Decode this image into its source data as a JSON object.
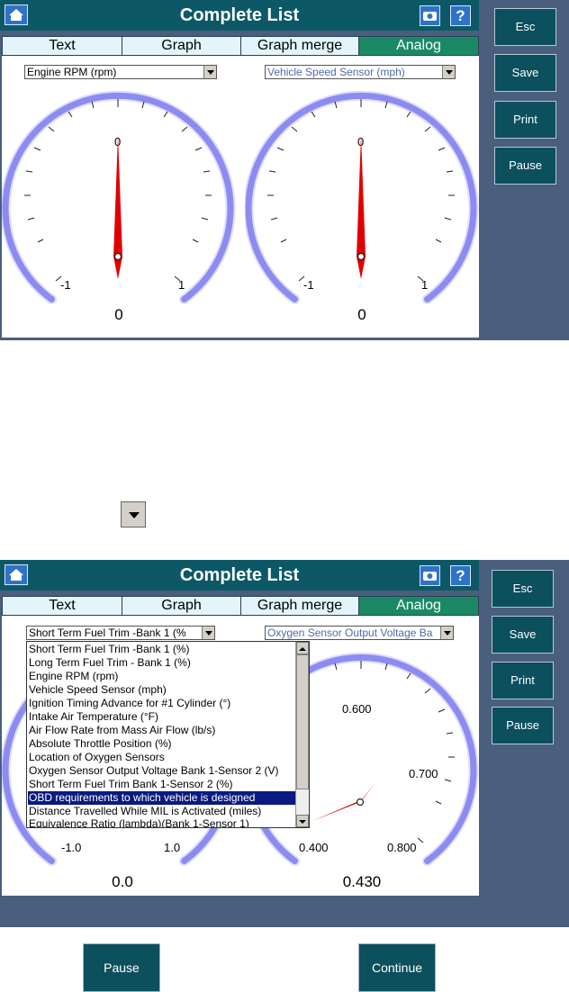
{
  "top_screen": {
    "title": "Complete List",
    "tabs": [
      {
        "label": "Text",
        "active": false
      },
      {
        "label": "Graph",
        "active": false
      },
      {
        "label": "Graph merge",
        "active": false
      },
      {
        "label": "Analog",
        "active": true
      }
    ],
    "side_buttons": [
      "Esc",
      "Save",
      "Print",
      "Pause"
    ],
    "left_select": "Engine RPM (rpm)",
    "right_select": "Vehicle Speed Sensor (mph)",
    "left_gauge": {
      "min_label": "-1",
      "mid_label": "0",
      "max_label": "1",
      "value": "0"
    },
    "right_gauge": {
      "min_label": "-1",
      "mid_label": "0",
      "max_label": "1",
      "value": "0"
    }
  },
  "bottom_screen": {
    "title": "Complete List",
    "tabs": [
      {
        "label": "Text",
        "active": false
      },
      {
        "label": "Graph",
        "active": false
      },
      {
        "label": "Graph merge",
        "active": false
      },
      {
        "label": "Analog",
        "active": true
      }
    ],
    "side_buttons": [
      "Esc",
      "Save",
      "Print",
      "Pause"
    ],
    "left_select": "Short Term Fuel Trim -Bank 1 (%",
    "right_select": "Oxygen Sensor Output Voltage Ba",
    "dropdown_items": [
      "Short Term Fuel Trim -Bank 1 (%)",
      "Long Term Fuel Trim - Bank 1 (%)",
      "Engine RPM (rpm)",
      "Vehicle Speed Sensor (mph)",
      "Ignition Timing Advance for #1 Cylinder (°)",
      "Intake Air Temperature (°F)",
      "Air Flow Rate from Mass Air Flow (lb/s)",
      "Absolute Throttle Position (%)",
      "Location of Oxygen Sensors",
      "Oxygen Sensor Output Voltage Bank 1-Sensor 2 (V)",
      "Short Term Fuel Trim Bank 1-Sensor 2 (%)",
      "OBD requirements to which vehicle is designed",
      "Distance Travelled While MIL is Activated (miles)",
      "Equivalence Ratio (lambda)(Bank 1-Sensor 1)"
    ],
    "selected_item_index": 11,
    "left_gauge": {
      "min_label": "-1.0",
      "max_label": "1.0",
      "value": "0.0"
    },
    "right_gauge": {
      "labels": [
        "0.600",
        "0.700",
        "0.400",
        "0.800"
      ],
      "value": "0.430"
    }
  },
  "bottom_buttons": {
    "pause": "Pause",
    "continue": "Continue"
  },
  "colors": {
    "titlebar": "#0d5867",
    "frame": "#4a5e7e",
    "active_tab": "#1b8a64",
    "needle": "#e00000",
    "gauge_ring": "#8c8cf0"
  }
}
